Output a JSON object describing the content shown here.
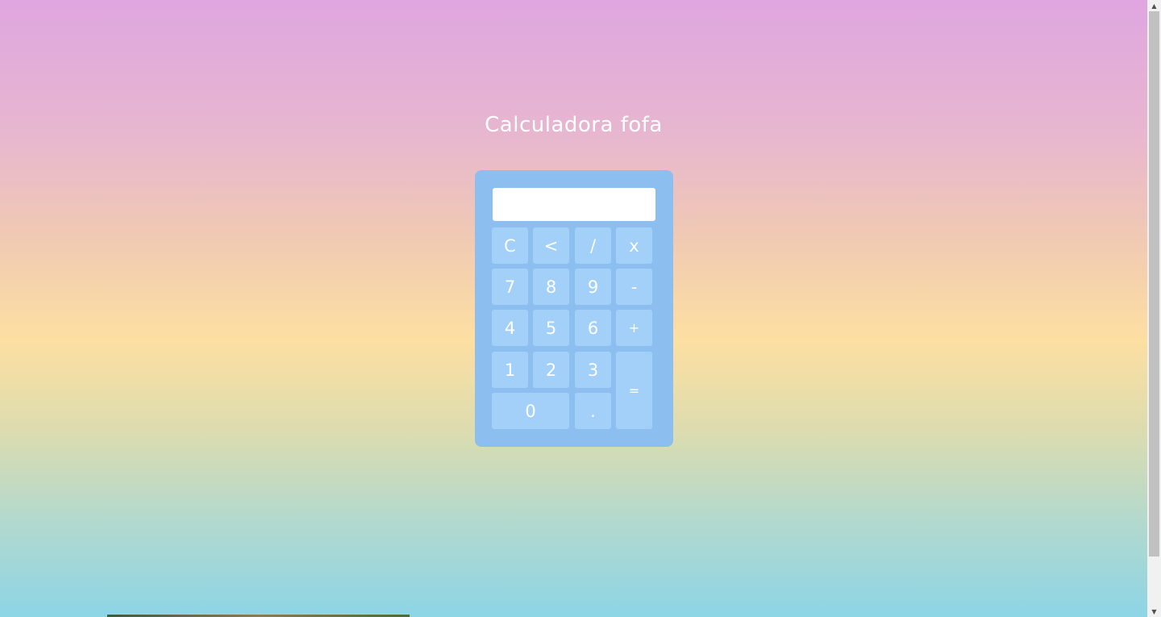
{
  "page": {
    "title": "Calculadora fofa"
  },
  "calculator": {
    "display_value": "",
    "keys": {
      "clear": "C",
      "backspace": "<",
      "divide": "/",
      "multiply": "x",
      "seven": "7",
      "eight": "8",
      "nine": "9",
      "minus": "-",
      "four": "4",
      "five": "5",
      "six": "6",
      "plus": "+",
      "one": "1",
      "two": "2",
      "three": "3",
      "equals": "=",
      "zero": "0",
      "dot": "."
    }
  },
  "colors": {
    "calculator_body": "#8cbff0",
    "key_background": "#a2d0f8",
    "display_background": "#ffffff",
    "gradient_top": "#dfa6e0",
    "gradient_middle": "#fddfa1",
    "gradient_bottom": "#8dd5e6"
  },
  "icons": {
    "scroll_up": "scroll-up-arrow-icon",
    "scroll_down": "scroll-down-arrow-icon"
  }
}
